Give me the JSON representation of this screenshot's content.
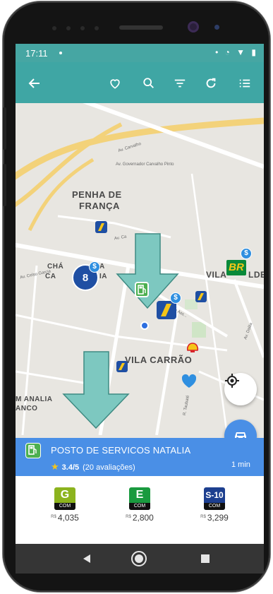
{
  "status_bar": {
    "time": "17:11",
    "icons_text": "• ◔ ▼ ▮"
  },
  "toolbar": {
    "back_icon": "arrow-left-icon",
    "favorite_icon": "heart-icon",
    "search_icon": "search-icon",
    "filter_icon": "filter-icon",
    "refresh_icon": "refresh-icon",
    "list_icon": "list-icon"
  },
  "map": {
    "area_labels": {
      "penha_line1": "PENHA DE",
      "penha_line2": "FRANÇA",
      "vila_carrao": "VILA CARRÃO",
      "cha_left": "CHÁ",
      "ca_left": "CA",
      "cha_right": "A",
      "ca_right": "IA",
      "vila_matilde": "VILA",
      "vila_matilde_right": "LDE",
      "jardim_left1": "M ANALIA",
      "jardim_left2": "ANCO"
    },
    "street_labels": {
      "av_governador": "Av. Governador Carvalho Pinto",
      "av_carvalho": "Av. Carvalho",
      "av_celso": "Av. Celso Garcia",
      "alameda": "Alameda Ass...",
      "av_dalila": "Av. Dalila",
      "r_taubate": "R. Taubaté",
      "av_ca": "Av. Ca"
    },
    "cluster_count": "8",
    "br_brand_text": "BR",
    "fab_locate_icon": "crosshair-icon",
    "fab_car_icon": "car-icon",
    "route_time": "1 min"
  },
  "station": {
    "name": "POSTO DE SERVICOS NATALIA",
    "rating": "3.4/5",
    "reviews": "(20 avaliações)",
    "icon": "fuel-pump-icon"
  },
  "prices": [
    {
      "letter": "G",
      "tag": "COM",
      "currency": "R$",
      "value": "4,035",
      "color": "#8cb31e"
    },
    {
      "letter": "E",
      "tag": "COM",
      "currency": "R$",
      "value": "2,800",
      "color": "#1a9a3f"
    },
    {
      "letter": "S-10",
      "tag": "COM",
      "currency": "R$",
      "value": "3,299",
      "color": "#1d3f8f"
    }
  ],
  "navbar": {
    "back_icon": "triangle-back-icon",
    "home_icon": "home-circle-icon",
    "recents_icon": "square-recents-icon"
  },
  "colors": {
    "accent": "#3fa6a4",
    "bar_blue": "#4a8fe6",
    "arrow": "#7dc8c0"
  }
}
